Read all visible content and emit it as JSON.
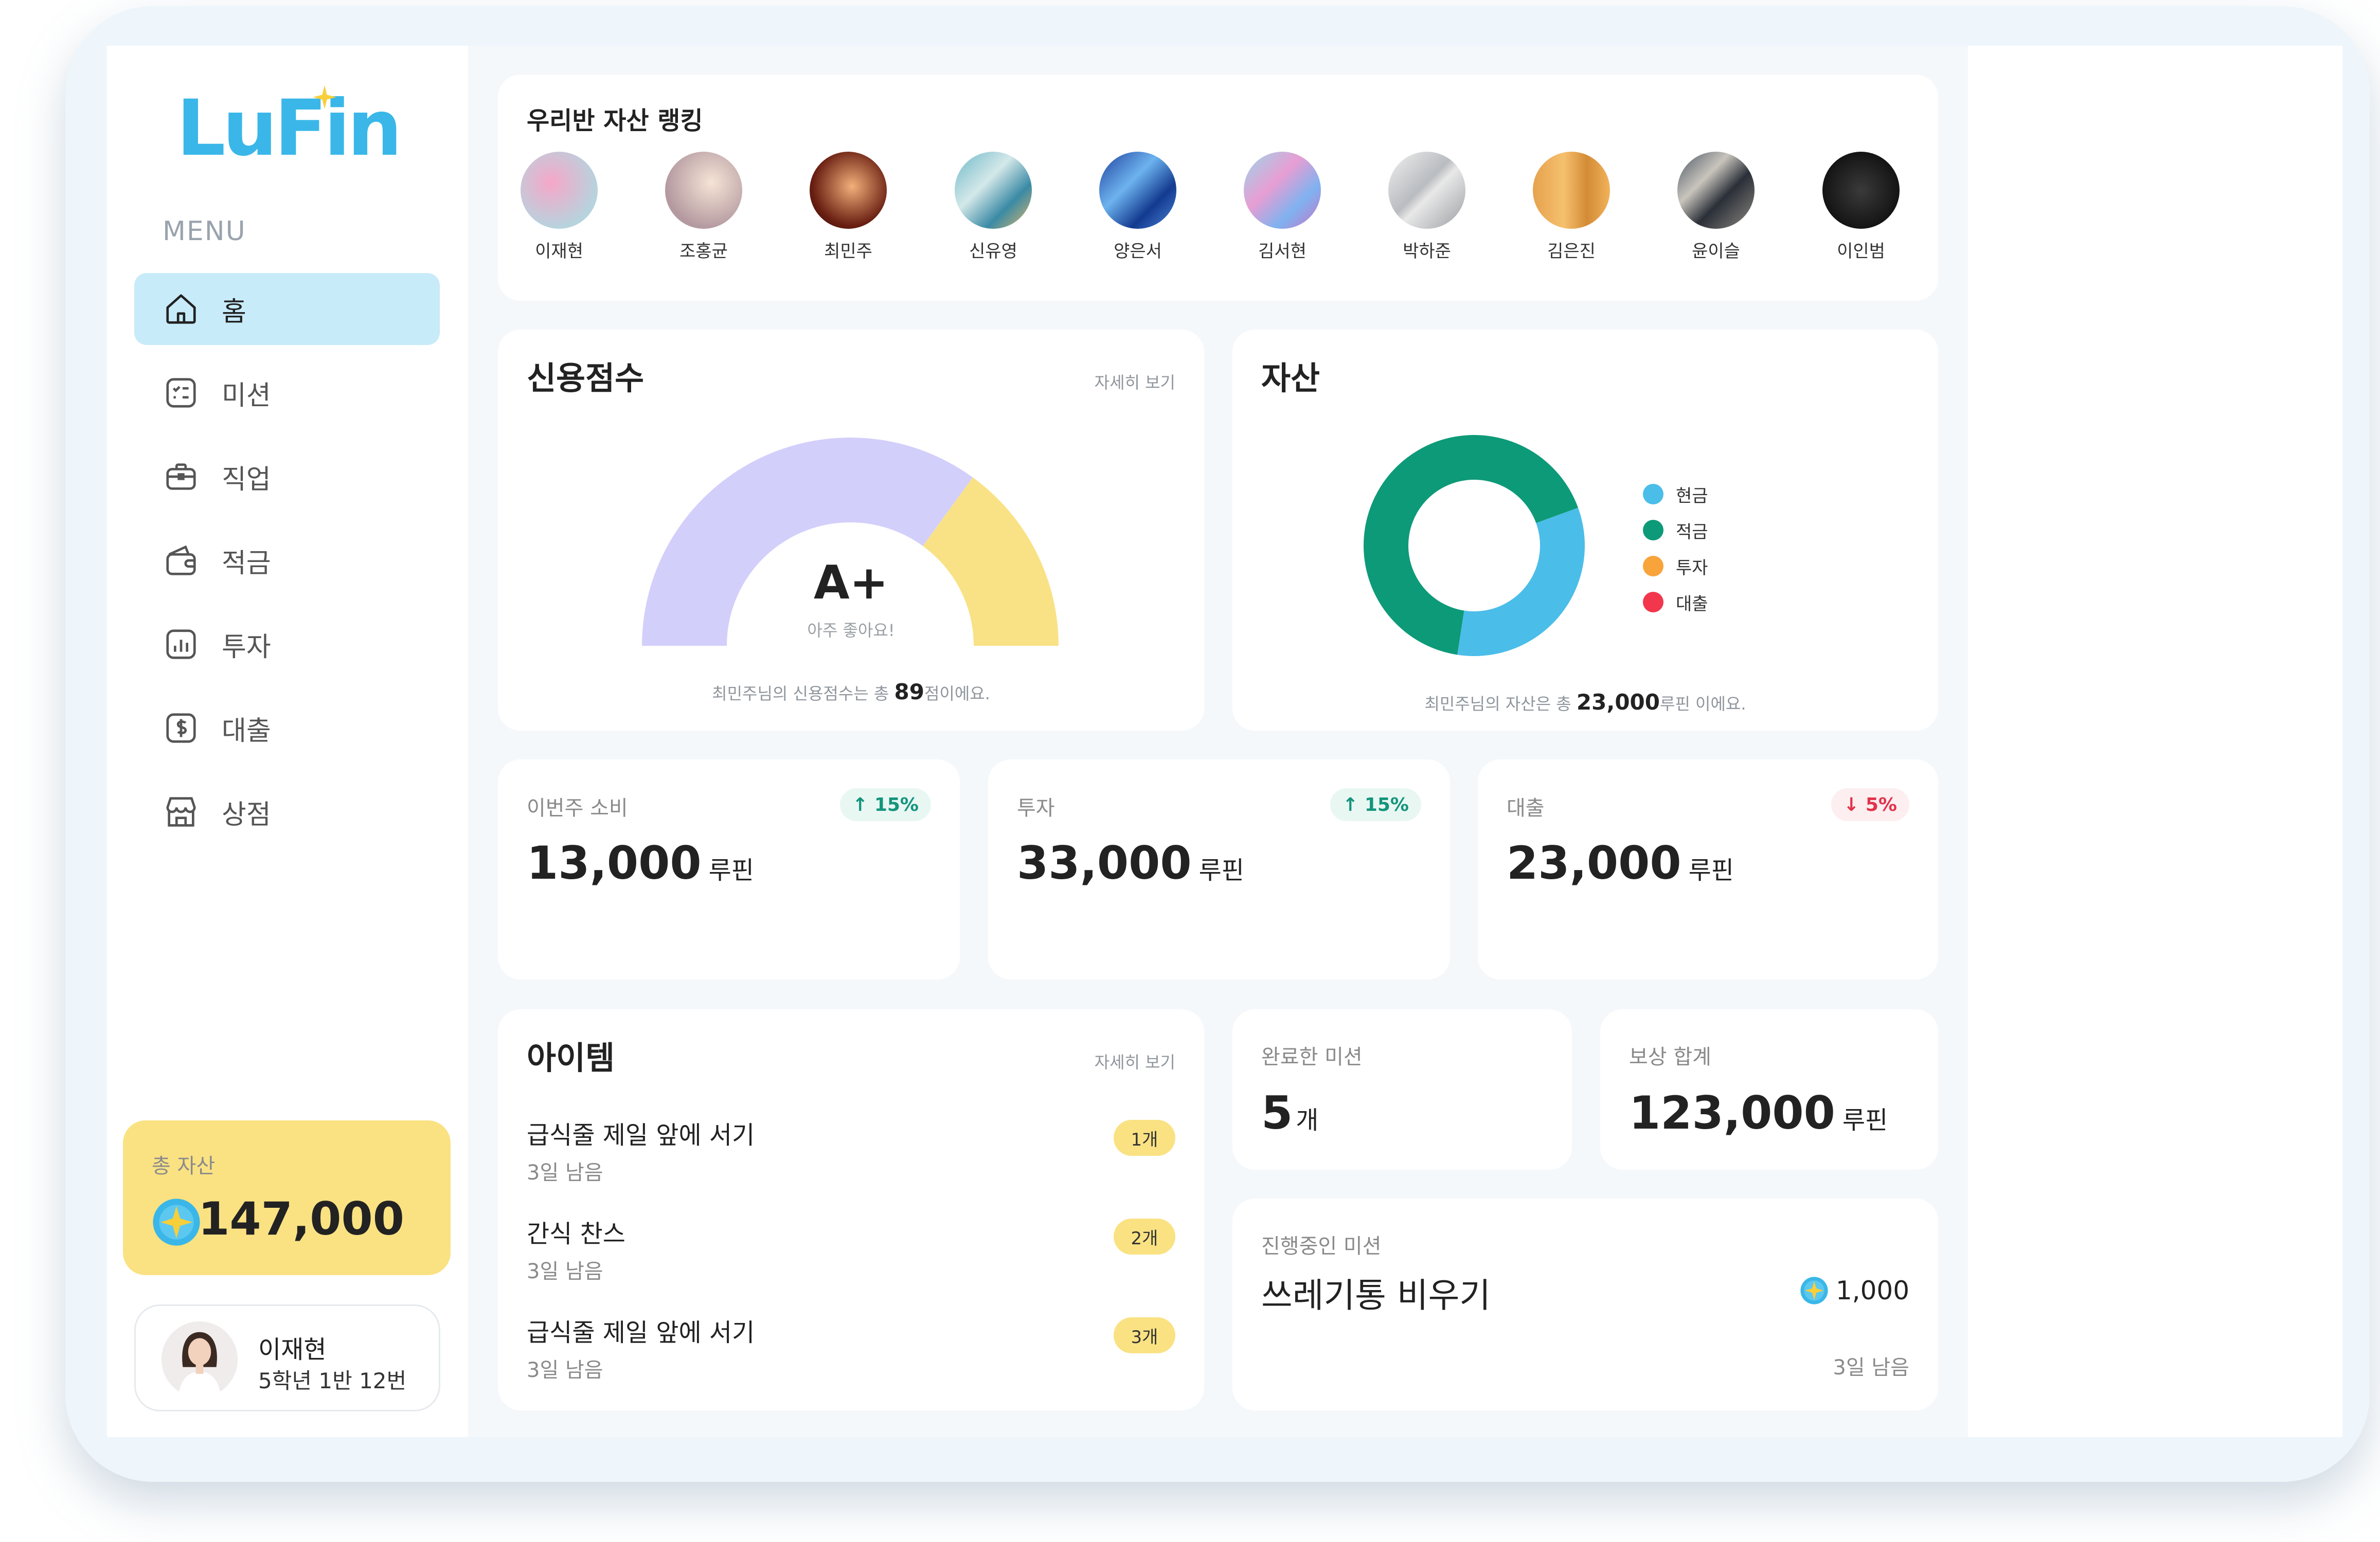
{
  "app": {
    "logo_text": "LuFin"
  },
  "sidebar": {
    "menu_label": "MENU",
    "items": [
      {
        "label": "홈",
        "icon": "home-icon",
        "active": true
      },
      {
        "label": "미션",
        "icon": "checklist-icon",
        "active": false
      },
      {
        "label": "직업",
        "icon": "briefcase-icon",
        "active": false
      },
      {
        "label": "적금",
        "icon": "wallet-icon",
        "active": false
      },
      {
        "label": "투자",
        "icon": "chart-icon",
        "active": false
      },
      {
        "label": "대출",
        "icon": "dollar-icon",
        "active": false
      },
      {
        "label": "상점",
        "icon": "store-icon",
        "active": false
      }
    ],
    "total_assets": {
      "label": "총 자산",
      "value": "147,000",
      "icon": "lufin-coin-icon"
    },
    "profile": {
      "name": "이재현",
      "class_info": "5학년 1반 12번"
    }
  },
  "ranking": {
    "title": "우리반 자산 랭킹",
    "students": [
      {
        "name": "이재현"
      },
      {
        "name": "조홍균"
      },
      {
        "name": "최민주"
      },
      {
        "name": "신유영"
      },
      {
        "name": "양은서"
      },
      {
        "name": "김서현"
      },
      {
        "name": "박하준"
      },
      {
        "name": "김은진"
      },
      {
        "name": "윤이슬"
      },
      {
        "name": "이인범"
      }
    ]
  },
  "credit": {
    "title": "신용점수",
    "detail_link": "자세히 보기",
    "grade": "A+",
    "grade_comment": "아주 좋아요!",
    "score": 89,
    "caption_prefix": "최민주님의 신용점수는 총 ",
    "caption_value": "89",
    "caption_suffix": "점이에요.",
    "colors": {
      "filled": "#d2cffb",
      "rest": "#f9e286"
    }
  },
  "assets": {
    "title": "자산",
    "caption_prefix": "최민주님의 자산은 총 ",
    "caption_value": "23,000",
    "caption_suffix": "루핀 이에요.",
    "legend": [
      {
        "label": "현금",
        "color": "#4bbde9"
      },
      {
        "label": "적금",
        "color": "#0d9a78"
      },
      {
        "label": "투자",
        "color": "#f9a33b"
      },
      {
        "label": "대출",
        "color": "#f2364c"
      }
    ]
  },
  "chart_data": {
    "type": "pie",
    "categories": [
      "현금",
      "적금",
      "투자",
      "대출"
    ],
    "values": [
      33,
      67,
      0,
      0
    ]
  },
  "stats": [
    {
      "label": "이번주 소비",
      "value": "13,000",
      "unit": "루핀",
      "change": "15%",
      "direction": "up",
      "arrow": "↑"
    },
    {
      "label": "투자",
      "value": "33,000",
      "unit": "루핀",
      "change": "15%",
      "direction": "up",
      "arrow": "↑"
    },
    {
      "label": "대출",
      "value": "23,000",
      "unit": "루핀",
      "change": "5%",
      "direction": "down",
      "arrow": "↓"
    }
  ],
  "items_card": {
    "title": "아이템",
    "detail_link": "자세히 보기",
    "items": [
      {
        "name": "급식줄 제일 앞에 서기",
        "remaining": "3일 남음",
        "count": "1개"
      },
      {
        "name": "간식 찬스",
        "remaining": "3일 남음",
        "count": "2개"
      },
      {
        "name": "급식줄 제일 앞에 서기",
        "remaining": "3일 남음",
        "count": "3개"
      }
    ]
  },
  "missions": {
    "completed": {
      "label": "완료한 미션",
      "value": "5",
      "unit": "개"
    },
    "reward_total": {
      "label": "보상 합계",
      "value": "123,000",
      "unit": "루핀"
    },
    "ongoing": {
      "label": "진행중인 미션",
      "title": "쓰레기통 비우기",
      "reward": "1,000",
      "remaining": "3일 남음"
    }
  }
}
